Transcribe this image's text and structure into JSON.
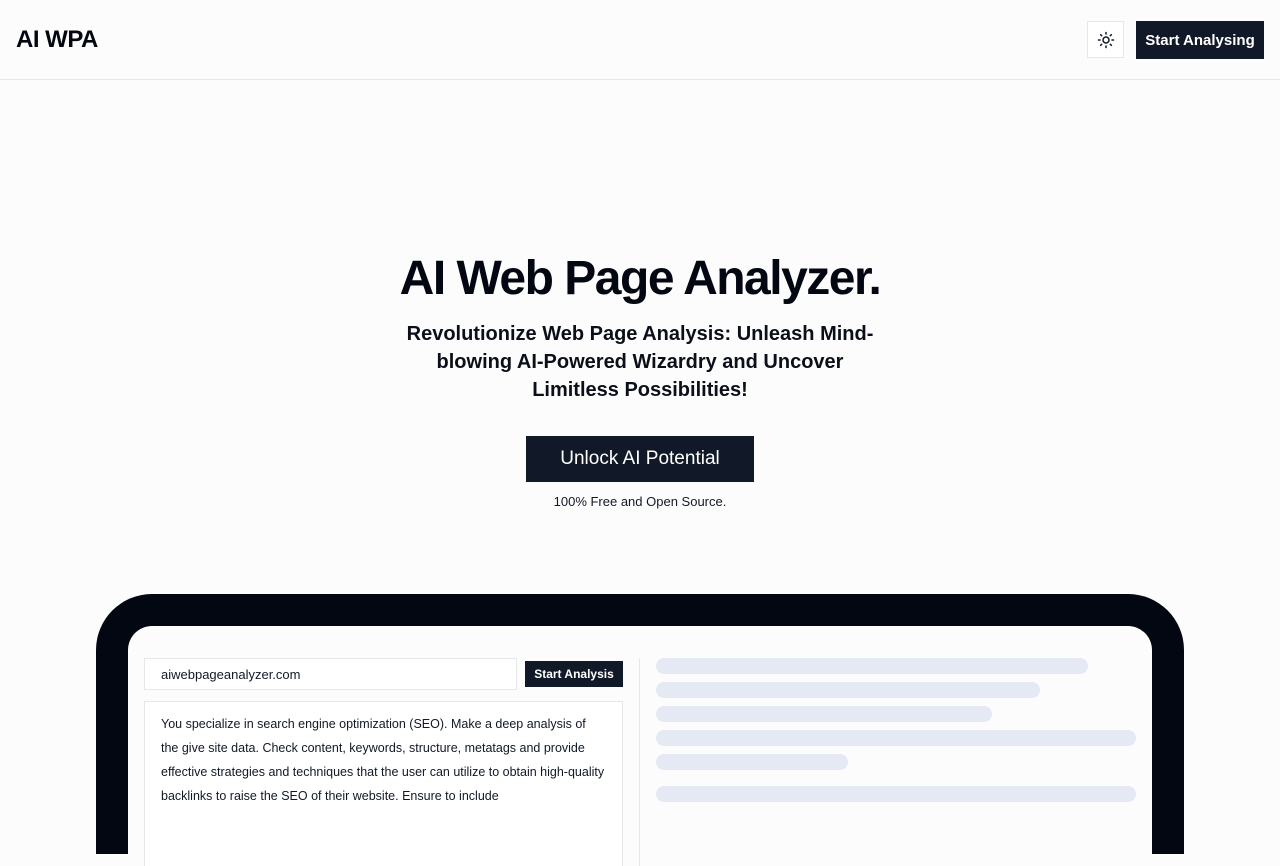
{
  "header": {
    "logo": "AI WPA",
    "theme_toggle_icon": "sun-icon",
    "cta_label": "Start Analysing"
  },
  "hero": {
    "title": "AI Web Page Analyzer.",
    "subtitle": "Revolutionize Web Page Analysis: Unleash Mind-blowing AI-Powered Wizardry and Uncover Limitless Possibilities!",
    "cta_label": "Unlock AI Potential",
    "note": "100% Free and Open Source."
  },
  "demo": {
    "url_value": "aiwebpageanalyzer.com",
    "analysis_button_label": "Start Analysis",
    "prompt_text": "You specialize in search engine optimization (SEO). Make a deep analysis of the give site data. Check content, keywords, structure, metatags and provide effective strategies and techniques that the user can utilize to obtain high-quality backlinks to raise the SEO of their website. Ensure to include"
  },
  "colors": {
    "primary": "#111827",
    "device_frame": "#030712",
    "skeleton": "#e5e9f4",
    "border": "#e5e7eb"
  }
}
